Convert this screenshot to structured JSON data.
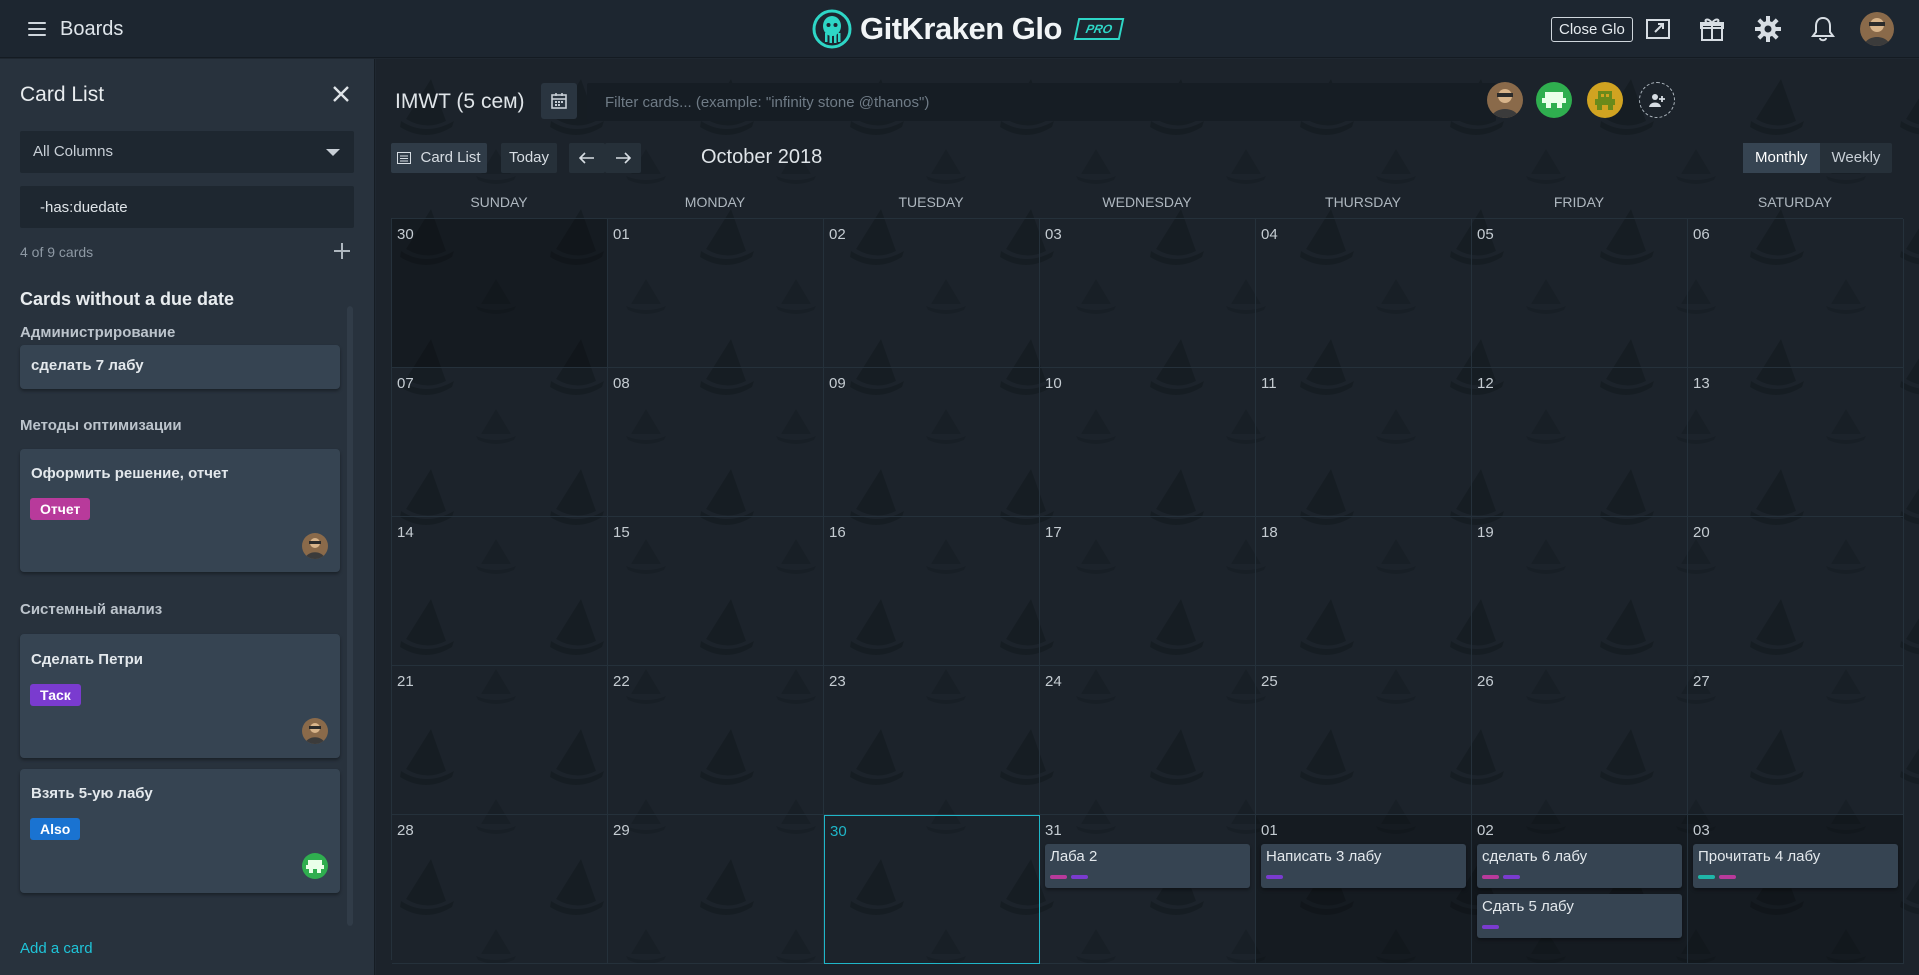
{
  "header": {
    "boards_label": "Boards",
    "app_name": "GitKraken Glo",
    "pro_badge": "PRO",
    "close_glo_label": "Close Glo"
  },
  "sidebar": {
    "title": "Card List",
    "column_select": "All Columns",
    "filter_value": "-has:duedate",
    "count_text": "4 of 9 cards",
    "section_title": "Cards without a due date",
    "groups": [
      {
        "label": "Администрирование",
        "cards": [
          {
            "title": "сделать 7 лабу"
          }
        ]
      },
      {
        "label": "Методы оптимизации",
        "cards": [
          {
            "title": "Оформить решение, отчет",
            "label": "Отчет",
            "label_color": "#b83a9b"
          }
        ]
      },
      {
        "label": "Системный анализ",
        "cards": [
          {
            "title": "Сделать Петри",
            "label": "Таск",
            "label_color": "#7a3bcf"
          },
          {
            "title": "Взять 5-ую лабу",
            "label": "Also",
            "label_color": "#1a73d1"
          }
        ]
      }
    ],
    "add_card_label": "Add a card"
  },
  "toolbar": {
    "board_title": "IMWT (5 сем)",
    "filter_placeholder": "Filter cards... (example: \"infinity stone @thanos\")",
    "card_list_btn": "Card List",
    "today_btn": "Today",
    "month_label": "October 2018",
    "monthly_label": "Monthly",
    "weekly_label": "Weekly"
  },
  "calendar": {
    "weekdays": [
      "SUNDAY",
      "MONDAY",
      "TUESDAY",
      "WEDNESDAY",
      "THURSDAY",
      "FRIDAY",
      "SATURDAY"
    ],
    "weeks": [
      [
        "30",
        "01",
        "02",
        "03",
        "04",
        "05",
        "06"
      ],
      [
        "07",
        "08",
        "09",
        "10",
        "11",
        "12",
        "13"
      ],
      [
        "14",
        "15",
        "16",
        "17",
        "18",
        "19",
        "20"
      ],
      [
        "21",
        "22",
        "23",
        "24",
        "25",
        "26",
        "27"
      ],
      [
        "28",
        "29",
        "30",
        "31",
        "01",
        "02",
        "03"
      ]
    ],
    "events": {
      "oct31": {
        "title": "Лаба 2",
        "labels": [
          "#b83a9b",
          "#7a3bcf"
        ]
      },
      "nov01": {
        "title": "Написать 3 лабу",
        "labels": [
          "#7a3bcf"
        ]
      },
      "nov02a": {
        "title": "сделать 6 лабу",
        "labels": [
          "#b83a9b",
          "#7a3bcf"
        ]
      },
      "nov02b": {
        "title": "Сдать 5 лабу",
        "labels": [
          "#7a3bcf"
        ]
      },
      "nov03": {
        "title": "Прочитать 4 лабу",
        "labels": [
          "#1fb6a8",
          "#b83a9b"
        ]
      }
    }
  },
  "colors": {
    "accent": "#1fc4d8",
    "today_border": "#1fb6c8",
    "logo": "#2ed6c6"
  }
}
